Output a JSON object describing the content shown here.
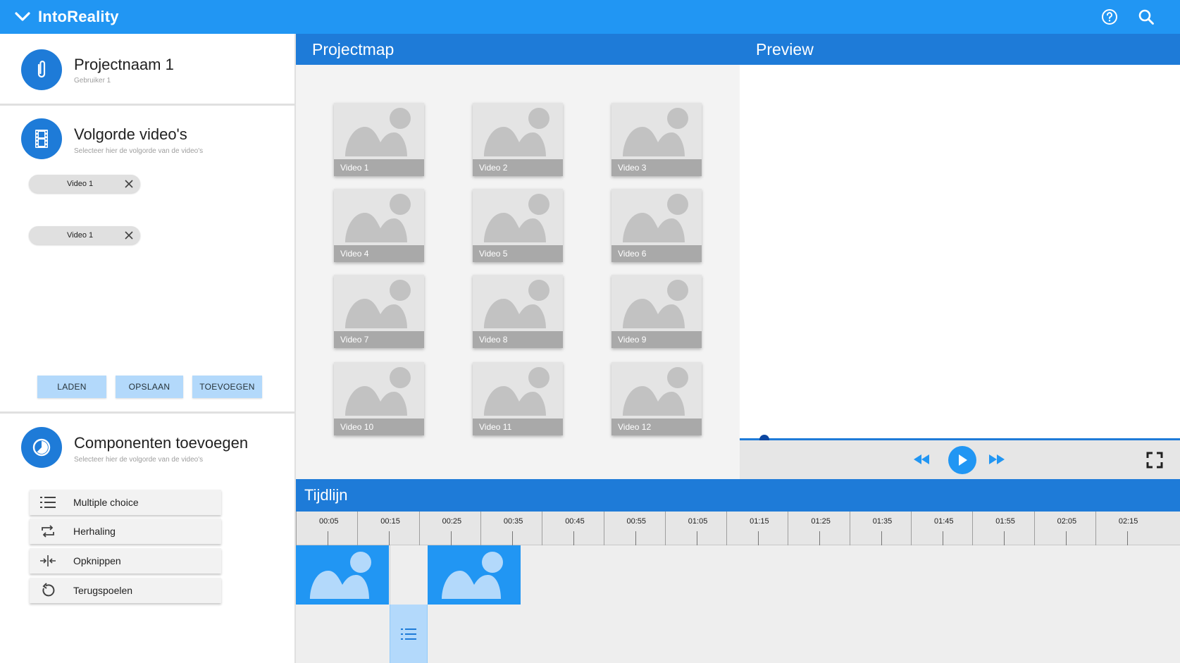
{
  "app": {
    "title": "IntoReality"
  },
  "project": {
    "name": "Projectnaam 1",
    "user": "Gebruiker 1"
  },
  "order": {
    "title": "Volgorde video's",
    "subtitle": "Selecteer hier de volgorde van de video's",
    "chips": [
      {
        "label": "Video 1"
      },
      {
        "label": "Video 1"
      }
    ],
    "buttons": {
      "load": "LADEN",
      "save": "OPSLAAN",
      "add": "TOEVOEGEN"
    }
  },
  "components": {
    "title": "Componenten toevoegen",
    "subtitle": "Selecteer hier de volgorde van de video's",
    "items": [
      {
        "label": "Multiple choice",
        "icon": "list-icon"
      },
      {
        "label": "Herhaling",
        "icon": "repeat-icon"
      },
      {
        "label": "Opknippen",
        "icon": "split-icon"
      },
      {
        "label": "Terugspoelen",
        "icon": "rewind-icon"
      }
    ]
  },
  "projectmap": {
    "title": "Projectmap",
    "videos": [
      "Video 1",
      "Video 2",
      "Video 3",
      "Video 4",
      "Video 5",
      "Video 6",
      "Video 7",
      "Video 8",
      "Video 9",
      "Video 10",
      "Video 11",
      "Video 12"
    ]
  },
  "preview": {
    "title": "Preview"
  },
  "timeline": {
    "title": "Tijdlijn",
    "ticks": [
      "00:05",
      "00:15",
      "00:25",
      "00:35",
      "00:45",
      "00:55",
      "01:05",
      "01:15",
      "01:25",
      "01:35",
      "01:45",
      "01:55",
      "02:05",
      "02:15"
    ]
  },
  "colors": {
    "primary": "#2196f3",
    "header": "#1e7bd8",
    "button": "#b3d9fb"
  }
}
